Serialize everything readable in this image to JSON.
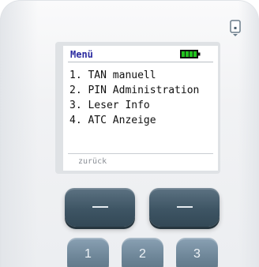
{
  "screen": {
    "title": "Menü",
    "battery_color": "#22c21f",
    "menu_items": [
      {
        "label": "1. TAN manuell"
      },
      {
        "label": "2. PIN Administration"
      },
      {
        "label": "3. Leser Info"
      },
      {
        "label": "4. ATC Anzeige"
      }
    ],
    "back_label": "zurück"
  },
  "keys": {
    "num_1": "1",
    "num_2": "2",
    "num_3": "3"
  },
  "icons": {
    "card_slot": "card-slot-icon",
    "battery": "battery-icon"
  }
}
